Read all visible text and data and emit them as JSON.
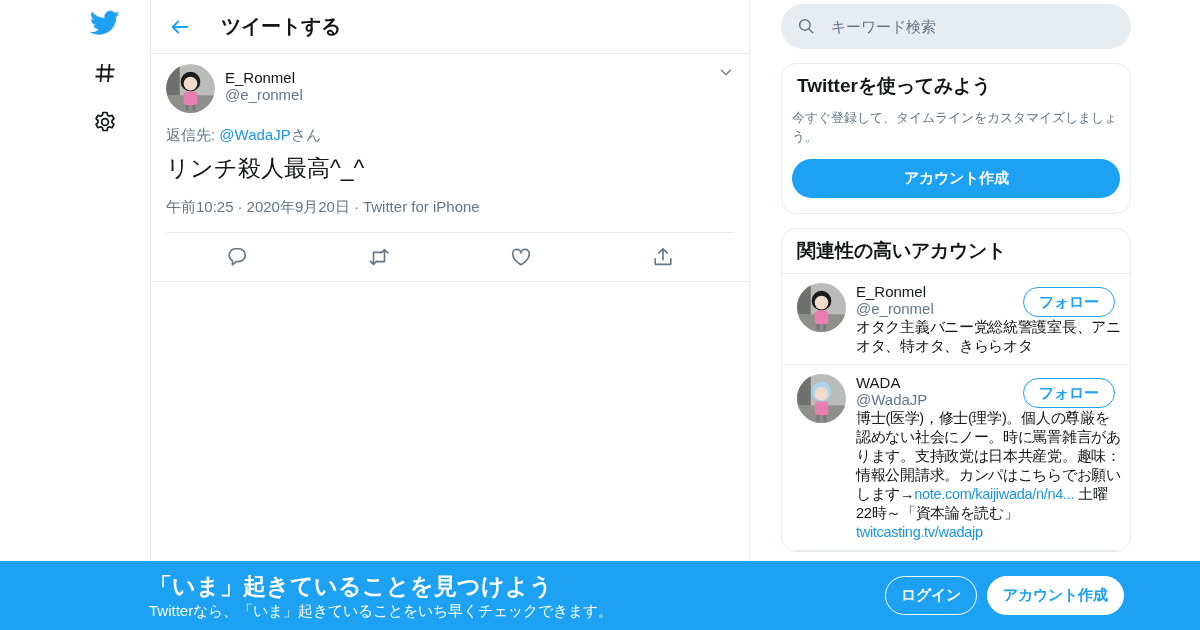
{
  "nav": {
    "items": [
      {
        "kind": "logo"
      },
      {
        "kind": "hashtag"
      },
      {
        "kind": "settings"
      }
    ]
  },
  "header": {
    "title": "ツイートする"
  },
  "tweet": {
    "name": "E_Ronmel",
    "handle": "@e_ronmel",
    "reply_label": "返信先:",
    "reply_to": "@WadaJP",
    "reply_suffix": "さん",
    "text": "リンチ殺人最高^_^",
    "time": "午前10:25",
    "separator": "·",
    "date": "2020年9月20日",
    "source": "Twitter for iPhone",
    "actions": [
      {
        "kind": "reply"
      },
      {
        "kind": "retweet"
      },
      {
        "kind": "like"
      },
      {
        "kind": "share"
      }
    ]
  },
  "search": {
    "placeholder": "キーワード検索"
  },
  "signup_card": {
    "title": "Twitterを使ってみよう",
    "text": "今すぐ登録して、タイムラインをカスタマイズしましょう。",
    "button": "アカウント作成"
  },
  "related": {
    "title": "関連性の高いアカウント",
    "accounts": [
      {
        "name": "E_Ronmel",
        "handle": "@e_ronmel",
        "button": "フォロー",
        "bio": [
          {
            "text": "オタク主義バニー党総統警護室長、アニオタ、特オタ、きららオタ"
          }
        ]
      },
      {
        "name": "WADA",
        "handle": "@WadaJP",
        "button": "フォロー",
        "bio": [
          {
            "text": "博士(医学)，修士(理学)。個人の尊厳を認めない社会にノー。時に罵詈雑言があります。支持政党は日本共産党。趣味：情報公開請求。カンパはこちらでお願いします→"
          },
          {
            "link": "note.com/kaijiwada/n/n4..."
          },
          {
            "text": " 土曜22時～「資本論を読む」"
          },
          {
            "link": "twitcasting.tv/wadajp"
          }
        ]
      }
    ]
  },
  "banner": {
    "title": "「いま」起きていることを見つけよう",
    "subtitle": "Twitterなら、「いま」起きていることをいち早くチェックできます。",
    "buttons": [
      {
        "kind": "outline",
        "label": "ログイン"
      },
      {
        "kind": "solid",
        "label": "アカウント作成"
      }
    ]
  }
}
